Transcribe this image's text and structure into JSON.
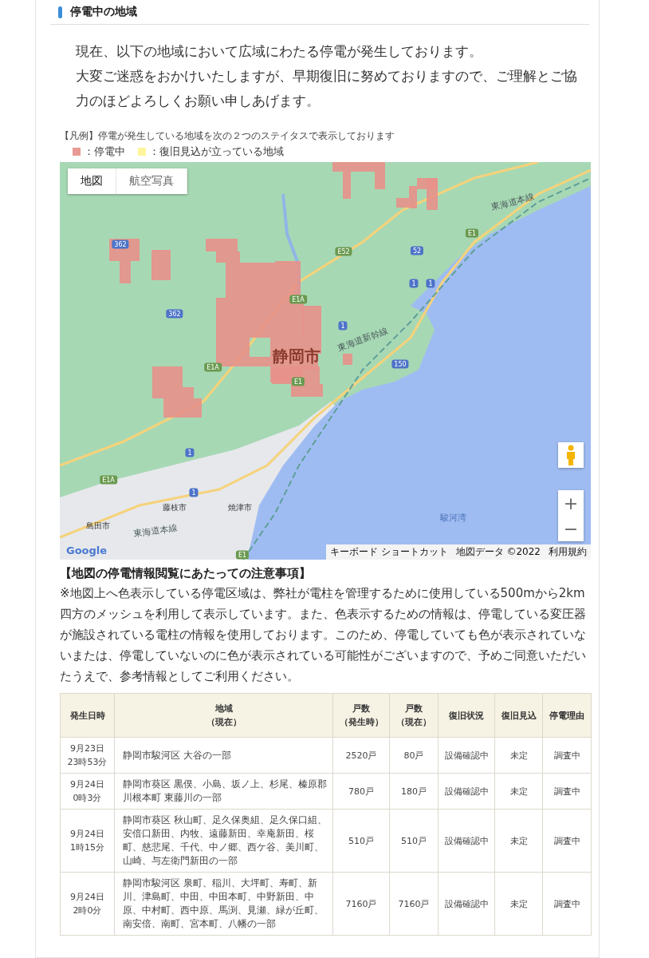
{
  "section": {
    "title": "停電中の地域"
  },
  "intro": [
    "現在、以下の地域において広域にわたる停電が発生しております。",
    "大変ご迷惑をおかけいたしますが、早期復旧に努めておりますので、ご理解とご協力のほどよろしくお願い申しあげます。"
  ],
  "legend": {
    "caption": "【凡例】停電が発生している地域を次の２つのステイタスで表示しております",
    "items": [
      {
        "label": "：停電中",
        "color": "#e89a94"
      },
      {
        "label": "：復旧見込が立っている地域",
        "color": "#fff59a"
      }
    ]
  },
  "map": {
    "type_tabs": [
      {
        "label": "地図",
        "selected": true
      },
      {
        "label": "航空写真",
        "selected": false
      }
    ],
    "labels": [
      {
        "kind": "city-major",
        "text": "静岡市"
      },
      {
        "kind": "city",
        "text": "藤枝市"
      },
      {
        "kind": "city",
        "text": "焼津市"
      },
      {
        "kind": "city",
        "text": "島田市"
      },
      {
        "kind": "water",
        "text": "駿河湾"
      },
      {
        "kind": "rail",
        "text": "東海道本線"
      },
      {
        "kind": "rail",
        "text": "東海道本線"
      },
      {
        "kind": "rail",
        "text": "東海道新幹線"
      },
      {
        "kind": "shield",
        "text": "362"
      },
      {
        "kind": "shield",
        "text": "362"
      },
      {
        "kind": "highway",
        "text": "E52"
      },
      {
        "kind": "highway",
        "text": "E1"
      },
      {
        "kind": "shield",
        "text": "52"
      },
      {
        "kind": "shield",
        "text": "1"
      },
      {
        "kind": "shield",
        "text": "1"
      },
      {
        "kind": "highway",
        "text": "E1A"
      },
      {
        "kind": "shield",
        "text": "1"
      },
      {
        "kind": "shield",
        "text": "150"
      },
      {
        "kind": "highway",
        "text": "E1A"
      },
      {
        "kind": "highway",
        "text": "E1"
      },
      {
        "kind": "shield",
        "text": "1"
      },
      {
        "kind": "highway",
        "text": "E1A"
      },
      {
        "kind": "shield",
        "text": "1"
      },
      {
        "kind": "highway",
        "text": "E1"
      }
    ],
    "logo": "Google",
    "zoom_in": "+",
    "zoom_out": "−",
    "attribution": [
      "キーボード ショートカット",
      "地図データ ©2022",
      "利用規約"
    ]
  },
  "notes": {
    "heading": "【地図の停電情報閲覧にあたっての注意事項】",
    "text": "※地図上へ色表示している停電区域は、弊社が電柱を管理するために使用している500mから2km四方のメッシュを利用して表示しています。また、色表示するための情報は、停電している変圧器が施設されている電柱の情報を使用しております。このため、停電していても色が表示されていないまたは、停電していないのに色が表示されている可能性がございますので、予めご同意いただいたうえで、参考情報としてご利用ください。"
  },
  "table": {
    "columns": [
      {
        "label": "発生日時"
      },
      {
        "label": "地域",
        "sub": "（現在）"
      },
      {
        "label": "戸数",
        "sub": "（発生時）"
      },
      {
        "label": "戸数",
        "sub": "（現在）"
      },
      {
        "label": "復旧状況"
      },
      {
        "label": "復旧見込"
      },
      {
        "label": "停電理由"
      }
    ],
    "rows": [
      [
        "9月23日\n23時53分",
        "静岡市駿河区 大谷の一部",
        "2520戸",
        "80戸",
        "設備確認中",
        "未定",
        "調査中"
      ],
      [
        "9月24日\n0時3分",
        "静岡市葵区 黒俣、小島、坂ノ上、杉尾、榛原郡川根本町 東藤川の一部",
        "780戸",
        "180戸",
        "設備確認中",
        "未定",
        "調査中"
      ],
      [
        "9月24日\n1時15分",
        "静岡市葵区 秋山町、足久保奥組、足久保口組、安倍口新田、内牧、遠藤新田、幸庵新田、桜町、慈悲尾、千代、中ノ郷、西ケ谷、美川町、山崎、与左衛門新田の一部",
        "510戸",
        "510戸",
        "設備確認中",
        "未定",
        "調査中"
      ],
      [
        "9月24日\n2時0分",
        "静岡市駿河区 泉町、稲川、大坪町、寿町、新川、津島町、中田、中田本町、中野新田、中原、中村町、西中原、馬渕、見瀬、緑が丘町、南安倍、南町、宮本町、八幡の一部",
        "7160戸",
        "7160戸",
        "設備確認中",
        "未定",
        "調査中"
      ]
    ]
  }
}
